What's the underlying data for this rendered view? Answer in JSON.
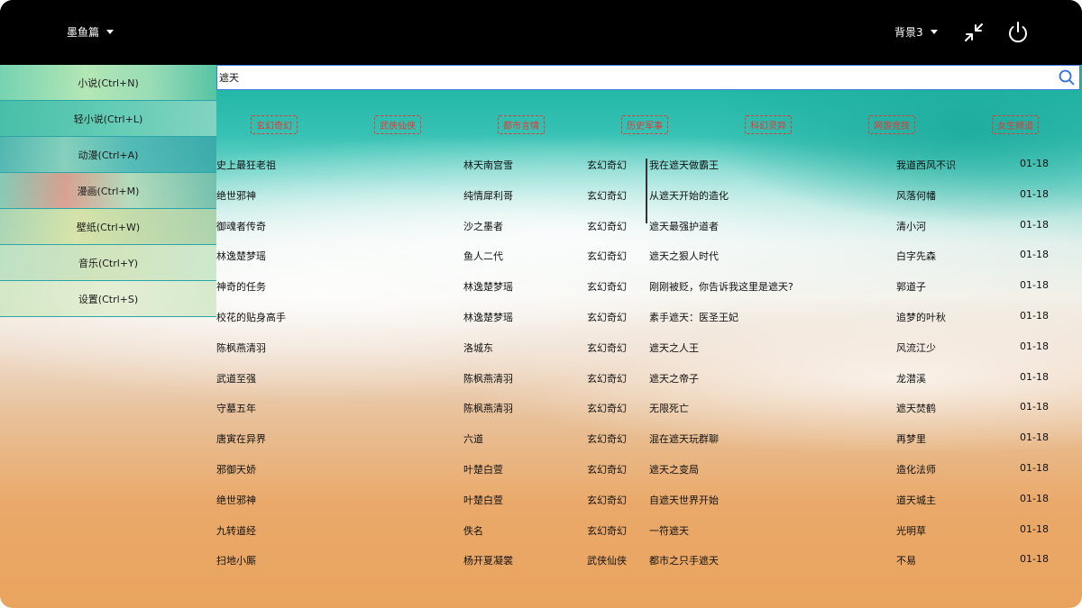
{
  "header": {
    "app_menu_label": "墨鱼篇",
    "background_menu_label": "背景3",
    "icons": [
      "collapse-icon",
      "power-icon",
      "chevron-down-icon"
    ]
  },
  "sidebar": {
    "items": [
      {
        "label": "小说(Ctrl+N)"
      },
      {
        "label": "轻小说(Ctrl+L)"
      },
      {
        "label": "动漫(Ctrl+A)"
      },
      {
        "label": "漫画(Ctrl+M)"
      },
      {
        "label": "壁纸(Ctrl+W)"
      },
      {
        "label": "音乐(Ctrl+Y)"
      },
      {
        "label": "设置(Ctrl+S)"
      }
    ]
  },
  "search": {
    "value": "遮天",
    "icon": "search-icon"
  },
  "categories": [
    {
      "label": "玄幻奇幻"
    },
    {
      "label": "武侠仙侠"
    },
    {
      "label": "都市言情"
    },
    {
      "label": "历史军事"
    },
    {
      "label": "科幻灵异"
    },
    {
      "label": "网游竞技"
    },
    {
      "label": "女生频道"
    }
  ],
  "results": [
    {
      "title": "史上最狂老祖",
      "author": "林天南宫雪",
      "category": "玄幻奇幻",
      "latest": "我在遮天做霸王",
      "updater": "我道西风不识",
      "date": "01-18"
    },
    {
      "title": "绝世邪神",
      "author": "纯情犀利哥",
      "category": "玄幻奇幻",
      "latest": "从遮天开始的造化",
      "updater": "风落何幡",
      "date": "01-18"
    },
    {
      "title": "御魂者传奇",
      "author": "沙之墨者",
      "category": "玄幻奇幻",
      "latest": "遮天最强护道者",
      "updater": "清小河",
      "date": "01-18"
    },
    {
      "title": "林逸楚梦瑶",
      "author": "鱼人二代",
      "category": "玄幻奇幻",
      "latest": "遮天之狠人时代",
      "updater": "白字先森",
      "date": "01-18"
    },
    {
      "title": "神奇的任务",
      "author": "林逸楚梦瑶",
      "category": "玄幻奇幻",
      "latest": "刚刚被贬，你告诉我这里是遮天?",
      "updater": "郭道子",
      "date": "01-18"
    },
    {
      "title": "校花的贴身高手",
      "author": "林逸楚梦瑶",
      "category": "玄幻奇幻",
      "latest": "素手遮天：医圣王妃",
      "updater": "追梦的叶秋",
      "date": "01-18"
    },
    {
      "title": "陈枫燕清羽",
      "author": "洛城东",
      "category": "玄幻奇幻",
      "latest": "遮天之人王",
      "updater": "风流江少",
      "date": "01-18"
    },
    {
      "title": "武道至强",
      "author": "陈枫燕清羽",
      "category": "玄幻奇幻",
      "latest": "遮天之帝子",
      "updater": "龙潜溪",
      "date": "01-18"
    },
    {
      "title": "守墓五年",
      "author": "陈枫燕清羽",
      "category": "玄幻奇幻",
      "latest": "无限死亡",
      "updater": "遮天焚鹤",
      "date": "01-18"
    },
    {
      "title": "唐寅在异界",
      "author": "六道",
      "category": "玄幻奇幻",
      "latest": "混在遮天玩群聊",
      "updater": "再梦里",
      "date": "01-18"
    },
    {
      "title": "邪御天娇",
      "author": "叶楚白萱",
      "category": "玄幻奇幻",
      "latest": "遮天之变局",
      "updater": "造化法师",
      "date": "01-18"
    },
    {
      "title": "绝世邪神",
      "author": "叶楚白萱",
      "category": "玄幻奇幻",
      "latest": "自遮天世界开始",
      "updater": "道天城主",
      "date": "01-18"
    },
    {
      "title": "九转道经",
      "author": "佚名",
      "category": "玄幻奇幻",
      "latest": "一符遮天",
      "updater": "光明草",
      "date": "01-18"
    },
    {
      "title": "扫地小厮",
      "author": "杨开夏凝裳",
      "category": "武侠仙侠",
      "latest": "都市之只手遮天",
      "updater": "不易",
      "date": "01-18"
    }
  ]
}
